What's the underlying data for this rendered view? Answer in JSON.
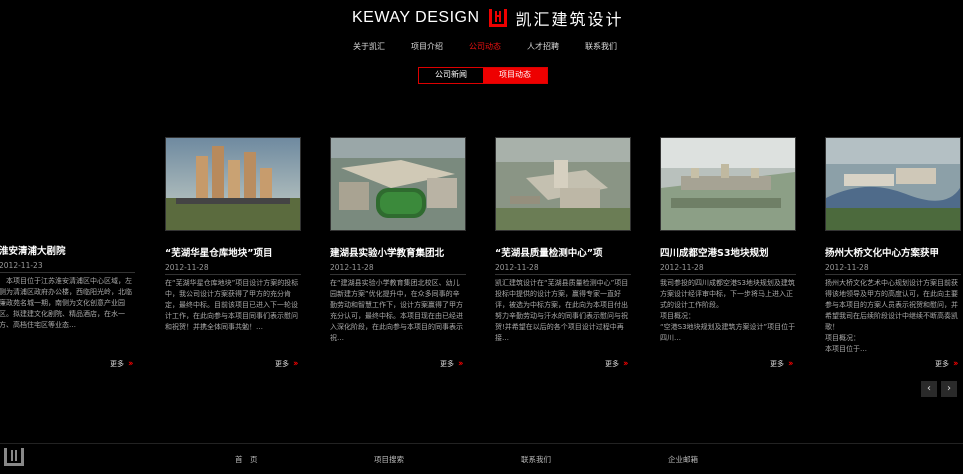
{
  "brand": {
    "name_en": "KEWAY DESIGN",
    "name_cn": "凯汇建筑设计"
  },
  "nav": [
    {
      "label": "关于凯汇",
      "active": false
    },
    {
      "label": "项目介绍",
      "active": false
    },
    {
      "label": "公司动态",
      "active": true
    },
    {
      "label": "人才招聘",
      "active": false
    },
    {
      "label": "联系我们",
      "active": false
    }
  ],
  "subtabs": [
    {
      "label": "公司新闻",
      "active": false
    },
    {
      "label": "项目动态",
      "active": true
    }
  ],
  "cards": [
    {
      "title": "淮安清浦大剧院",
      "date": "2012-11-23",
      "body": "　本项目位于江苏淮安清浦区中心区域，左侧为清浦区政府办公楼，西临阳光岭，北临廉政苑名城一期，南侧为文化创意产业园区。拟建建文化剧院、精品酒店，在水一方、高档住宅区等业态…",
      "more": "更多"
    },
    {
      "title": "“芜湖华星仓库地块”项目",
      "date": "2012-11-28",
      "body": "在“芜湖华星仓库地块”项目设计方案的投标中，我公司设计方案获得了甲方的充分肯定，最终中标。目前该项目已进入下一轮设计工作，在此向参与本项目同事们表示慰问和祝贺！并携全体同事共勉！…",
      "more": "更多"
    },
    {
      "title": "建湖县实验小学教育集团北",
      "date": "2012-11-28",
      "body": "在“建湖县实验小学教育集团北校区、幼儿园新建方案”优化提升中，在众多同事的辛勤劳动和智慧工作下，设计方案赢得了甲方充分认可，最终中标。本项目现在由已经进入深化阶段，在此向参与本项目的同事表示祝…",
      "more": "更多"
    },
    {
      "title": "“芜湖县质量检测中心”项",
      "date": "2012-11-28",
      "body": "凯汇建筑设计在“芜湖县质量检测中心”项目投标中提供的设计方案，赢得专家一直好评，被选为中标方案，在此向为本项目付出努力辛勤劳动与汗水的同事们表示慰问与祝贺!并希望在以后的各个项目设计过程中再接…",
      "more": "更多"
    },
    {
      "title": "四川成都空港S3地块规划",
      "date": "2012-11-28",
      "body": "我司参投的四川成都空港S3地块规划及建筑方案设计经评审中标，下一步将马上进入正式的设计工作阶段。\n项目概况：\n“空港S3地块规划及建筑方案设计”项目位于四川…",
      "more": "更多"
    },
    {
      "title": "扬州大桥文化中心方案获甲",
      "date": "2012-11-28",
      "body": "扬州大桥文化艺术中心规划设计方案目前获得该地领导及甲方的高度认可，在此向主要参与本项目的方案人员表示祝贺和慰问，并希望我司在后续阶段设计中继续不断高奏凯歌！\n项目概况：\n本项目位于…",
      "more": "更多"
    }
  ],
  "pager": {
    "prev": "‹",
    "next": "›"
  },
  "footer": [
    {
      "label": "首　页"
    },
    {
      "label": "项目搜索"
    },
    {
      "label": "联系我们"
    },
    {
      "label": "企业邮箱"
    }
  ],
  "colors": {
    "accent": "#e00000",
    "background": "#000000"
  }
}
